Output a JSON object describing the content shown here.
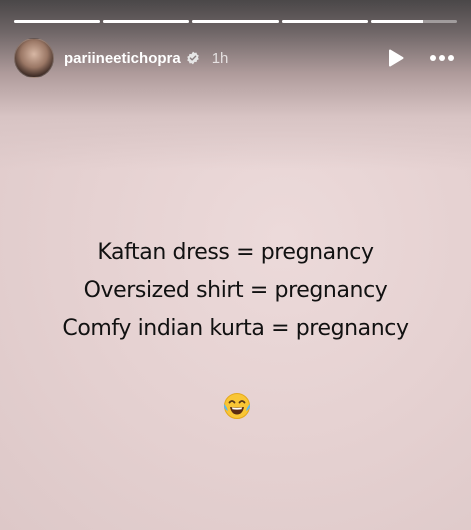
{
  "header": {
    "username": "pariineetichopra",
    "time": "1h",
    "verified_icon": "verified-badge-icon",
    "play_icon": "play-icon",
    "more_icon": "more-options-icon"
  },
  "progress": {
    "segments": [
      1,
      1,
      1,
      1,
      0.6
    ]
  },
  "story": {
    "lines": [
      "Kaftan dress = pregnancy",
      "Oversized shirt = pregnancy",
      "Comfy indian kurta = pregnancy"
    ],
    "emoji": "😂",
    "emoji_icon": "face-with-tears-of-joy-icon"
  },
  "colors": {
    "background": "#e6d2d2",
    "text": "#111111",
    "header_text": "#ffffff"
  }
}
